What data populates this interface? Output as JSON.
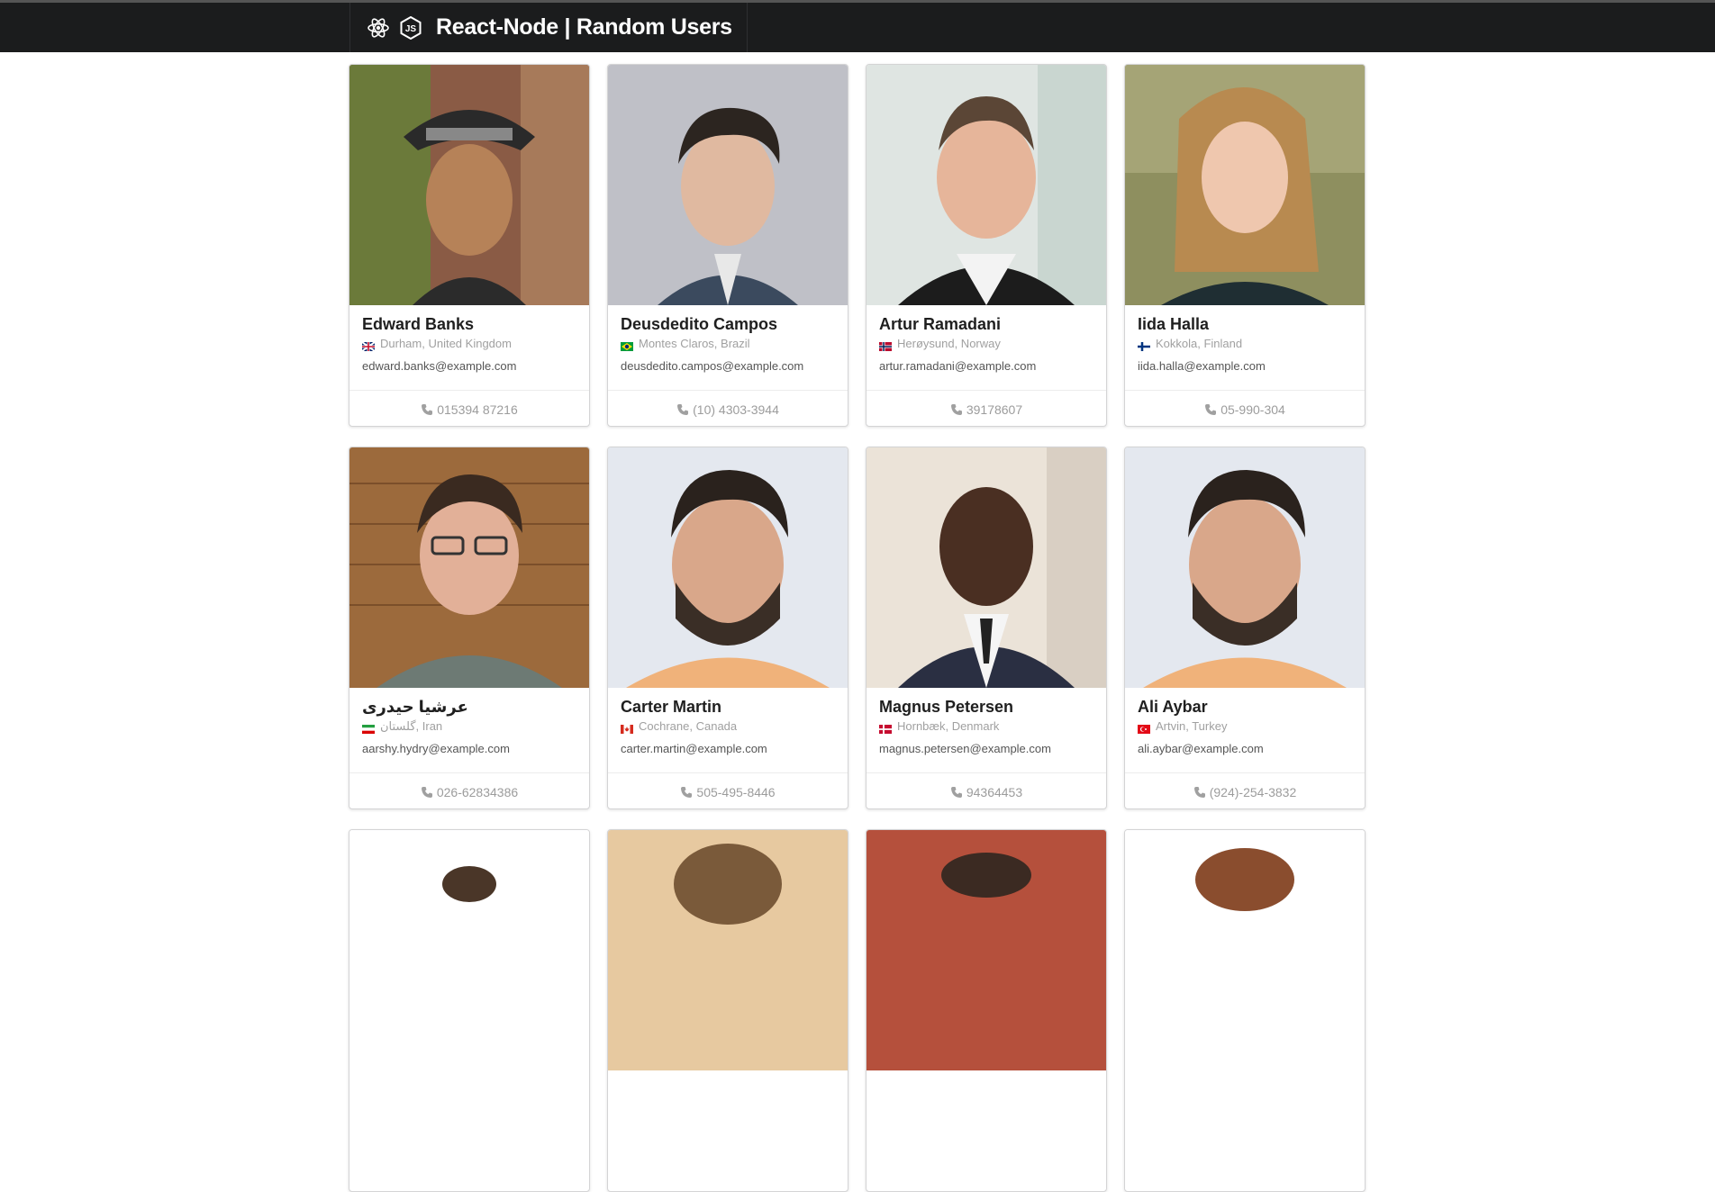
{
  "header": {
    "title": "React-Node | Random Users",
    "logos": [
      "react-logo",
      "nodejs-logo"
    ]
  },
  "users": [
    {
      "name": "Edward Banks",
      "location": "Durham, United Kingdom",
      "email": "edward.banks@example.com",
      "phone": "015394 87216",
      "flag": "gb"
    },
    {
      "name": "Deusdedito Campos",
      "location": "Montes Claros, Brazil",
      "email": "deusdedito.campos@example.com",
      "phone": "(10) 4303-3944",
      "flag": "br"
    },
    {
      "name": "Artur Ramadani",
      "location": "Herøysund, Norway",
      "email": "artur.ramadani@example.com",
      "phone": "39178607",
      "flag": "no"
    },
    {
      "name": "Iida Halla",
      "location": "Kokkola, Finland",
      "email": "iida.halla@example.com",
      "phone": "05-990-304",
      "flag": "fi"
    },
    {
      "name": "عرشیا حیدری",
      "location": "گلستان, Iran",
      "email": "aarshy.hydry@example.com",
      "phone": "026-62834386",
      "flag": "ir"
    },
    {
      "name": "Carter Martin",
      "location": "Cochrane, Canada",
      "email": "carter.martin@example.com",
      "phone": "505-495-8446",
      "flag": "ca"
    },
    {
      "name": "Magnus Petersen",
      "location": "Hornbæk, Denmark",
      "email": "magnus.petersen@example.com",
      "phone": "94364453",
      "flag": "dk"
    },
    {
      "name": "Ali Aybar",
      "location": "Artvin, Turkey",
      "email": "ali.aybar@example.com",
      "phone": "(924)-254-3832",
      "flag": "tr"
    }
  ],
  "icons": {
    "phone": "phone-icon"
  },
  "colors": {
    "topbar": "#1b1c1d",
    "name": "#1f1f1f",
    "meta": "#a0a0a0"
  }
}
